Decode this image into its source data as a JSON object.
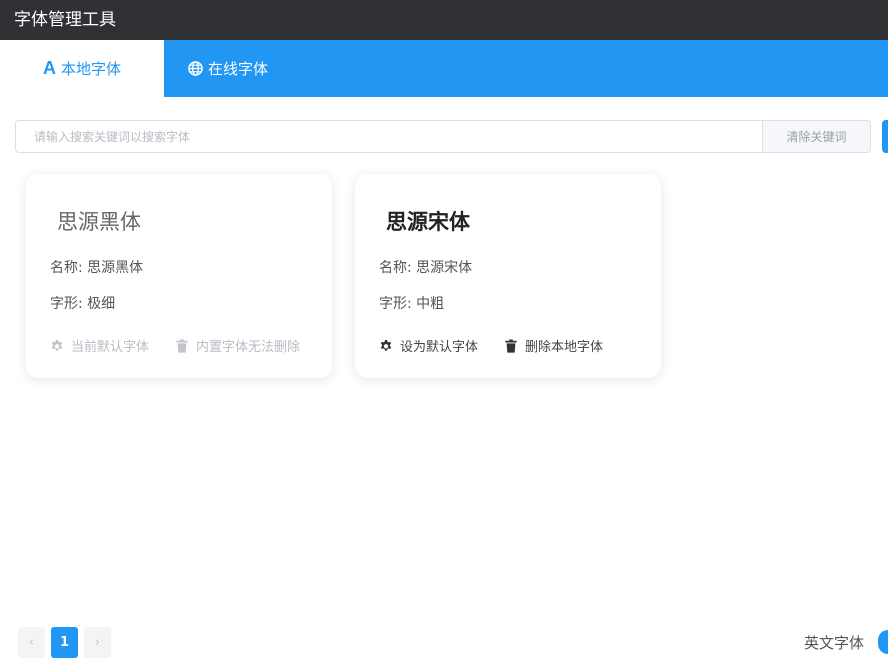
{
  "app": {
    "title": "字体管理工具"
  },
  "tabs": [
    {
      "label": "本地字体",
      "icon": "letter-a-icon",
      "icon_text": "A",
      "active": true
    },
    {
      "label": "在线字体",
      "icon": "globe-icon",
      "active": false
    }
  ],
  "search": {
    "placeholder": "请输入搜索关键词以搜索字体",
    "value": "",
    "clear_label": "清除关键词"
  },
  "fonts": [
    {
      "display_name": "思源黑体",
      "name_label": "名称:",
      "name": "思源黑体",
      "weight_label": "字形:",
      "weight": "极细",
      "actions": [
        {
          "label": "当前默认字体",
          "icon": "gear-icon",
          "enabled": false
        },
        {
          "label": "内置字体无法删除",
          "icon": "trash-icon",
          "enabled": false
        }
      ]
    },
    {
      "display_name": "思源宋体",
      "name_label": "名称:",
      "name": "思源宋体",
      "weight_label": "字形:",
      "weight": "中粗",
      "actions": [
        {
          "label": "设为默认字体",
          "icon": "gear-icon",
          "enabled": true
        },
        {
          "label": "删除本地字体",
          "icon": "trash-icon",
          "enabled": true
        }
      ]
    }
  ],
  "pagination": {
    "prev": "‹",
    "current": "1",
    "next": "›"
  },
  "footer": {
    "lang_label": "英文字体"
  },
  "colors": {
    "accent": "#2196f3",
    "titlebar": "#2f3134"
  }
}
